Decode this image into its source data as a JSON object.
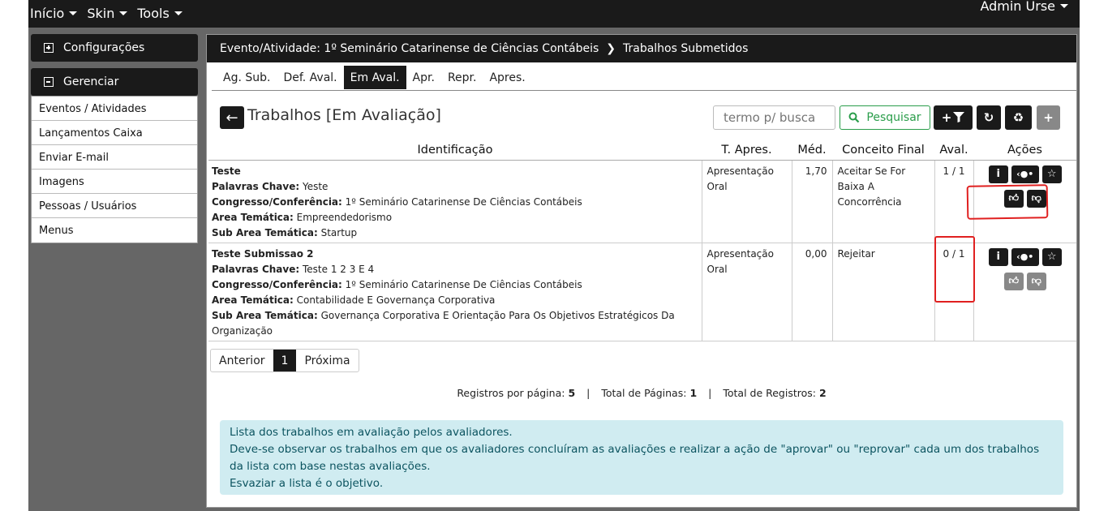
{
  "nav": {
    "menus": [
      "Início",
      "Skin",
      "Tools"
    ],
    "user": "Admin Urse"
  },
  "sidebar": {
    "config_label": "Configurações",
    "manage_label": "Gerenciar",
    "items": [
      "Eventos / Atividades",
      "Lançamentos Caixa",
      "Enviar E-mail",
      "Imagens",
      "Pessoas / Usuários",
      "Menus"
    ]
  },
  "breadcrumb": {
    "event": "Evento/Atividade: 1º Seminário Catarinense de Ciências Contábeis",
    "page": "Trabalhos Submetidos"
  },
  "tabs": [
    "Ag. Sub.",
    "Def. Aval.",
    "Em Aval.",
    "Apr.",
    "Repr.",
    "Apres."
  ],
  "active_tab": "Em Aval.",
  "title": "Trabalhos [Em Avaliação]",
  "search": {
    "placeholder": "termo p/ busca",
    "button_label": "Pesquisar"
  },
  "table": {
    "headers": [
      "Identificação",
      "T. Apres.",
      "Méd.",
      "Conceito Final",
      "Aval.",
      "Ações"
    ],
    "field_labels": {
      "keywords": "Palavras Chave:",
      "congress": "Congresso/Conferência:",
      "area": "Area Temática:",
      "subarea": "Sub Area Temática:"
    },
    "rows": [
      {
        "title": "Teste",
        "keywords": "Yeste",
        "congress": "1º Seminário Catarinense De Ciências Contábeis",
        "area": "Empreendedorismo",
        "subarea": "Startup",
        "t_apres": "Apresentação Oral",
        "med": "1,70",
        "conceito": "Aceitar Se For Baixa A Concorrência",
        "aval": "1 / 1",
        "aval_status": "complete"
      },
      {
        "title": "Teste Submissao 2",
        "keywords": "Teste 1 2 3 E 4",
        "congress": "1º Seminário Catarinense De Ciências Contábeis",
        "area": "Contabilidade E Governança Corporativa",
        "subarea": "Governança Corporativa E Orientação Para Os Objetivos Estratégicos Da Organização",
        "t_apres": "Apresentação Oral",
        "med": "0,00",
        "conceito": "Rejeitar",
        "aval": "0 / 1",
        "aval_status": "pending"
      }
    ]
  },
  "pager": {
    "prev": "Anterior",
    "current": "1",
    "next": "Próxima"
  },
  "stats": {
    "per_page_label": "Registros por página:",
    "per_page": "5",
    "pages_label": "Total de Páginas:",
    "pages": "1",
    "records_label": "Total de Registros:",
    "records": "2",
    "separator": "|"
  },
  "info": {
    "lines": [
      "Lista dos trabalhos em avaliação pelos avaliadores.",
      "Deve-se observar os trabalhos em que os avaliadores concluíram as avaliações e realizar a ação de \"aprovar\" ou \"reprovar\" cada um dos trabalhos da lista com base nestas avaliações.",
      "Esvaziar a lista é o objetivo."
    ]
  },
  "colors": {
    "dark": "#1a1a1a",
    "success": "#2a9d4a",
    "danger": "#c62828",
    "info_bg": "#d0ecf1",
    "annotation": "#e02020"
  }
}
